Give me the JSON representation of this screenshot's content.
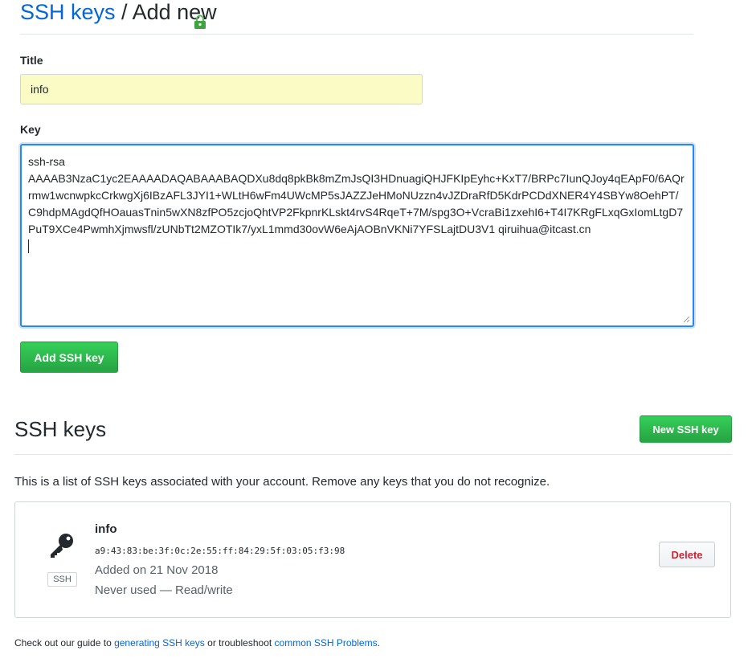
{
  "header": {
    "breadcrumb_link": "SSH keys",
    "breadcrumb_separator": " / ",
    "breadcrumb_current": "Add new"
  },
  "form": {
    "title_label": "Title",
    "title_value": "info",
    "key_label": "Key",
    "key_value": "ssh-rsa\nAAAAB3NzaC1yc2EAAAADAQABAAABAQDXu8dq8pkBk8mZmJsQI3HDnuagiQHJFKIpEyhc+KxT7/BRPc7IunQJoy4qEApF0/6AQrrmw1wcnwpkcCrkwgXj6IBzAFL3JYI1+WLtH6wFm4UWcMP5sJAZZJeHMoNUzzn4vJZDraRfD5KdrPCDdXNER4Y4SBYw8OehPT/C9hdpMAgdQfHOauasTnin5wXN8zfPO5zcjoQhtVP2FkpnrKLskt4rvS4RqeT+7M/spg3O+VcraBi1zxehI6+T4I7KRgFLxqGxIomLtgD7PuT9XCe4PwmhXjmwsfl/zUNbTt2MZOTIk7/yxL1mmd30ovW6eAjAOBnVKNi7YFSLajtDU3V1 qiruihua@itcast.cn",
    "add_button_label": "Add SSH key"
  },
  "keys_section": {
    "title": "SSH keys",
    "new_button_label": "New SSH key",
    "description": "This is a list of SSH keys associated with your account. Remove any keys that you do not recognize.",
    "keys": [
      {
        "name": "info",
        "fingerprint": "a9:43:83:be:3f:0c:2e:55:ff:84:29:5f:03:05:f3:98",
        "added": "Added on 21 Nov 2018",
        "usage": "Never used — Read/write",
        "badge": "SSH",
        "icon": "key-icon",
        "delete_label": "Delete"
      }
    ]
  },
  "footer": {
    "prefix": "Check out our guide to ",
    "link1": "generating SSH keys",
    "middle": " or troubleshoot ",
    "link2": "common SSH Problems",
    "suffix": "."
  },
  "colors": {
    "link": "#0366d6",
    "green_button": "#28a745",
    "title_input_bg": "#fafbc5",
    "delete_text": "#cb2431",
    "focus_border": "#2188ff"
  }
}
